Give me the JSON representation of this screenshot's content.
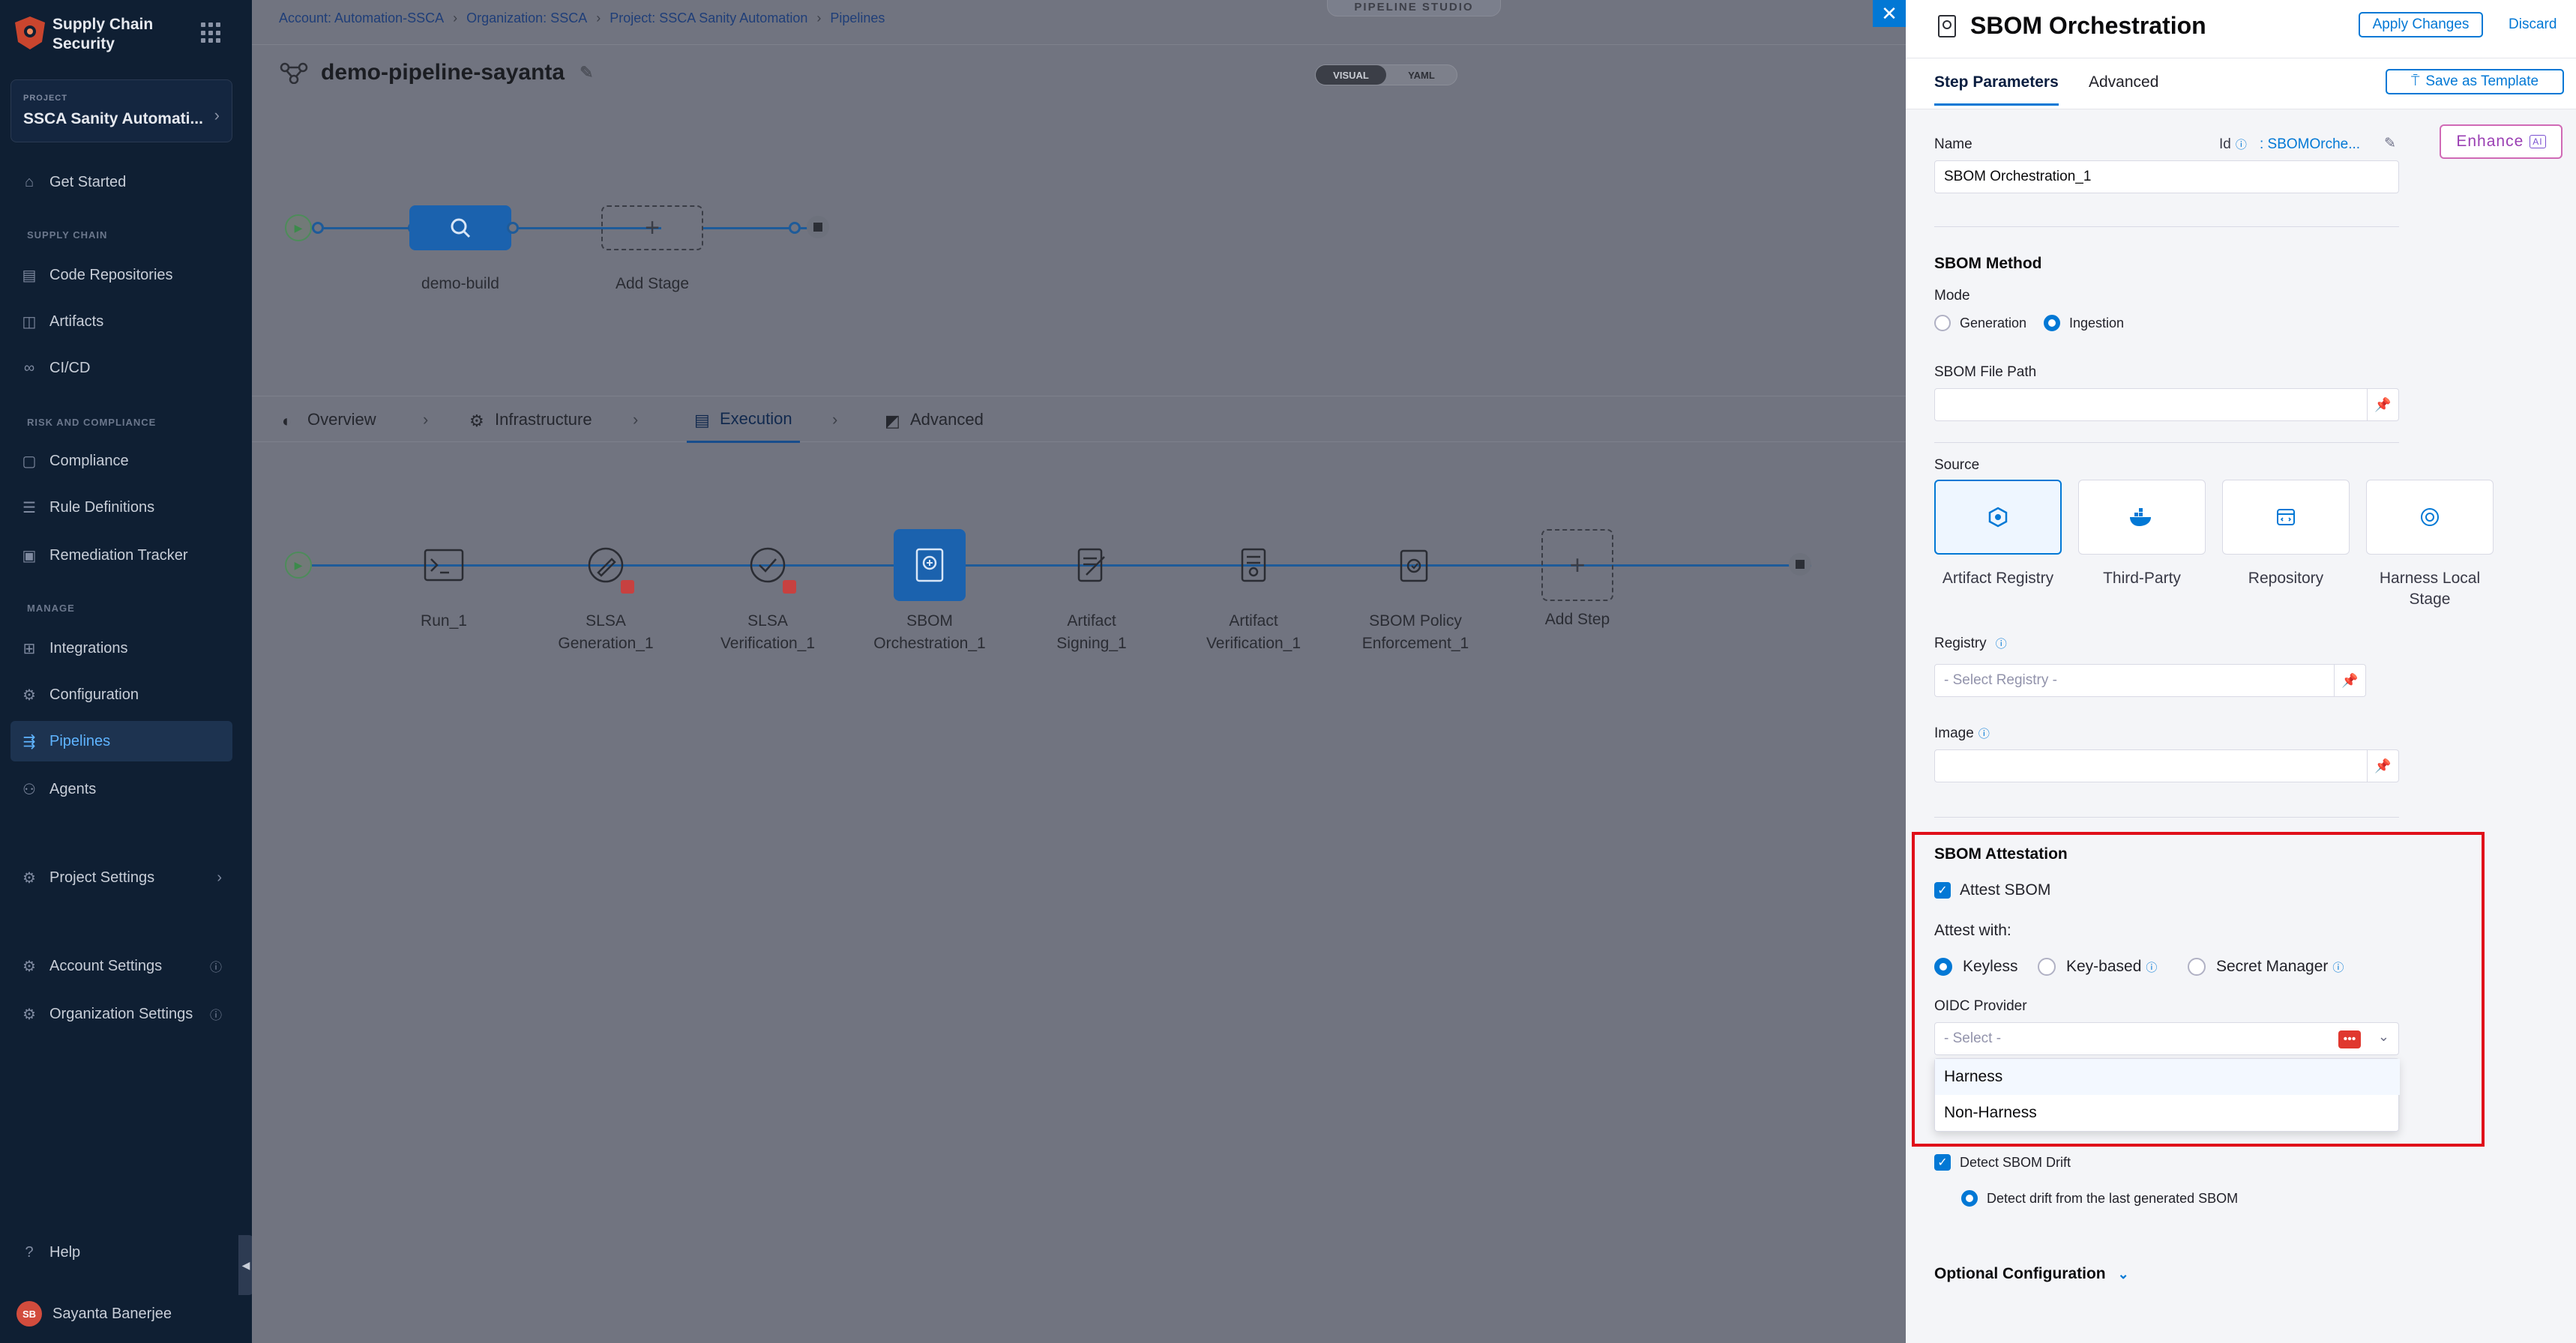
{
  "sidebar": {
    "module_title": "Supply Chain Security",
    "project_label": "PROJECT",
    "project_name": "SSCA Sanity Automati...",
    "items": [
      {
        "label": "Get Started"
      },
      {
        "label": "Code Repositories"
      },
      {
        "label": "Artifacts"
      },
      {
        "label": "CI/CD"
      },
      {
        "label": "Compliance"
      },
      {
        "label": "Rule Definitions"
      },
      {
        "label": "Remediation Tracker"
      },
      {
        "label": "Integrations"
      },
      {
        "label": "Configuration"
      },
      {
        "label": "Pipelines"
      },
      {
        "label": "Agents"
      },
      {
        "label": "Project Settings"
      },
      {
        "label": "Account Settings"
      },
      {
        "label": "Organization Settings"
      },
      {
        "label": "Help"
      }
    ],
    "sections": {
      "supply_chain": "SUPPLY CHAIN",
      "risk": "RISK AND COMPLIANCE",
      "manage": "MANAGE"
    },
    "user": {
      "initials": "SB",
      "name": "Sayanta Banerjee"
    }
  },
  "breadcrumbs": [
    "Account: Automation-SSCA",
    "Organization: SSCA",
    "Project: SSCA Sanity Automation",
    "Pipelines"
  ],
  "studio_badge": "PIPELINE STUDIO",
  "pipeline": {
    "name": "demo-pipeline-sayanta",
    "view_toggle": {
      "visual": "VISUAL",
      "yaml": "YAML"
    },
    "stages": [
      {
        "label": "demo-build"
      },
      {
        "label": "Add Stage"
      }
    ]
  },
  "stage_tabs": [
    {
      "label": "Overview"
    },
    {
      "label": "Infrastructure"
    },
    {
      "label": "Execution"
    },
    {
      "label": "Advanced"
    }
  ],
  "steps": [
    {
      "label": "Run_1"
    },
    {
      "label": "SLSA Generation_1"
    },
    {
      "label": "SLSA Verification_1"
    },
    {
      "label": "SBOM Orchestration_1"
    },
    {
      "label": "Artifact Signing_1"
    },
    {
      "label": "Artifact Verification_1"
    },
    {
      "label": "SBOM Policy Enforcement_1"
    },
    {
      "label": "Add Step"
    }
  ],
  "panel": {
    "title": "SBOM Orchestration",
    "apply_changes": "Apply Changes",
    "discard": "Discard",
    "tabs": {
      "step_params": "Step Parameters",
      "advanced": "Advanced"
    },
    "save_template": "Save as Template",
    "enhance": "Enhance",
    "enhance_badge": "AI",
    "name_label": "Name",
    "id_label": "Id",
    "id_value": ": SBOMOrche...",
    "name_value": "SBOM Orchestration_1",
    "sbom_method": "SBOM Method",
    "mode_label": "Mode",
    "mode_options": {
      "generation": "Generation",
      "ingestion": "Ingestion"
    },
    "file_path_label": "SBOM File Path",
    "file_path_value": "",
    "source_label": "Source",
    "sources": [
      {
        "label": "Artifact Registry"
      },
      {
        "label": "Third-Party"
      },
      {
        "label": "Repository"
      },
      {
        "label": "Harness Local Stage"
      }
    ],
    "registry_label": "Registry",
    "registry_placeholder": "- Select Registry -",
    "image_label": "Image",
    "image_value": "",
    "attestation": {
      "title": "SBOM Attestation",
      "attest_sbom": "Attest SBOM",
      "attest_with": "Attest with:",
      "options": {
        "keyless": "Keyless",
        "key_based": "Key-based",
        "secret_manager": "Secret Manager"
      },
      "oidc_label": "OIDC Provider",
      "oidc_placeholder": "- Select -",
      "oidc_options": [
        "Harness",
        "Non-Harness"
      ]
    },
    "detect_drift": "Detect SBOM Drift",
    "drift_option": "Detect drift from the last generated SBOM",
    "optional_config": "Optional Configuration"
  }
}
